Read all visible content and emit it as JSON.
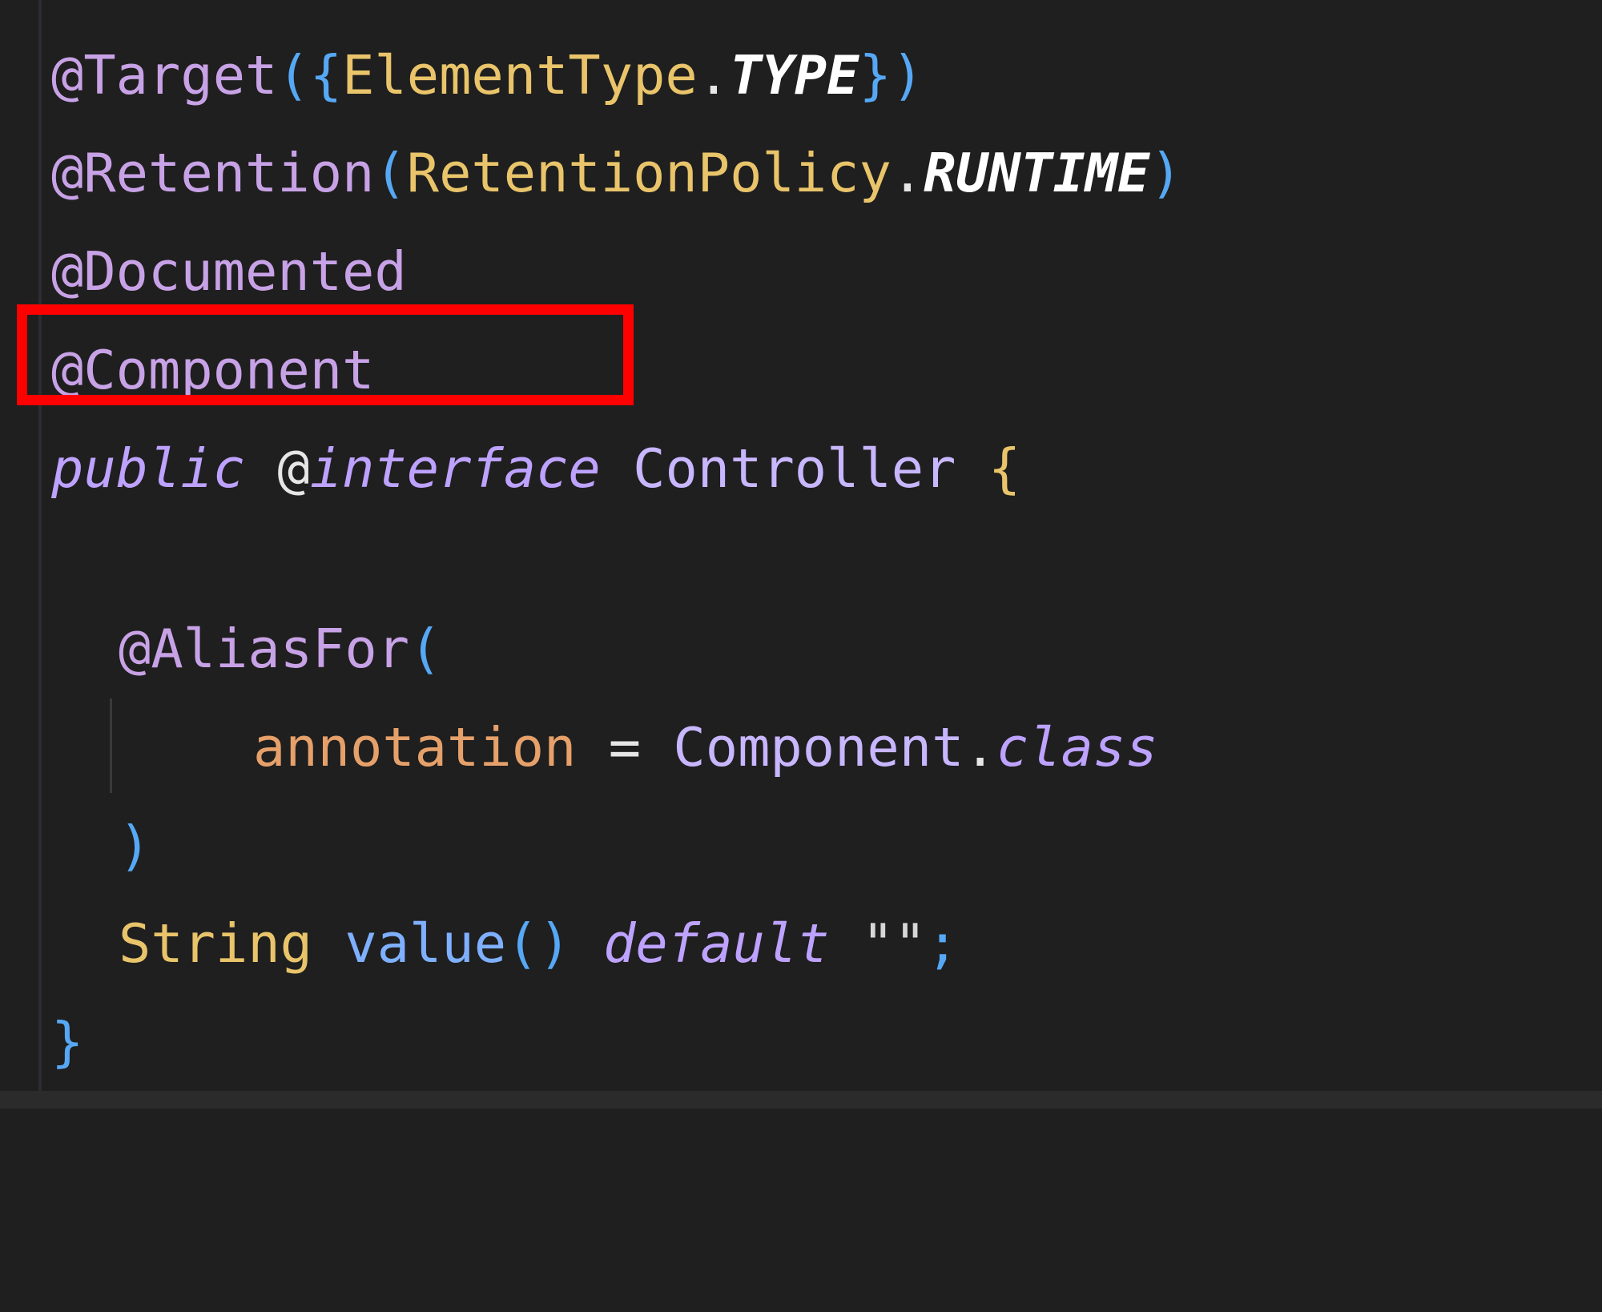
{
  "code": {
    "line1": {
      "at": "@",
      "name": "Target",
      "open": "({",
      "cls": "ElementType",
      "dot": ".",
      "const": "TYPE",
      "close": "})"
    },
    "line2": {
      "at": "@",
      "name": "Retention",
      "open": "(",
      "cls": "RetentionPolicy",
      "dot": ".",
      "const": "RUNTIME",
      "close": ")"
    },
    "line3": {
      "text": "@Documented"
    },
    "line4": {
      "text": "@Component"
    },
    "line5": {
      "kw1": "public",
      "kw2_at": "@",
      "kw2": "interface",
      "name": "Controller",
      "brace": "{"
    },
    "line7": {
      "at": "@",
      "name": "AliasFor",
      "open": "("
    },
    "line8": {
      "param": "annotation",
      "eq": "=",
      "type": "Component",
      "dot": ".",
      "cls": "class"
    },
    "line9": {
      "close": ")"
    },
    "line10": {
      "type": "String",
      "method": "value",
      "parens": "()",
      "kw": "default",
      "str": "\"\"",
      "semi": ";"
    },
    "line11": {
      "brace": "}"
    }
  },
  "highlight": {
    "color": "#ff0000",
    "target": "@Component"
  }
}
